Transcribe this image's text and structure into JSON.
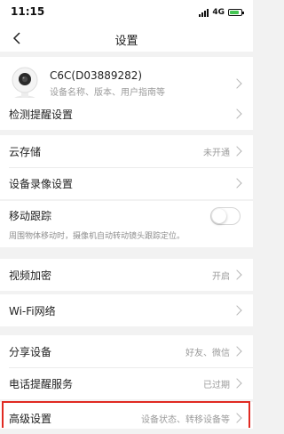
{
  "status_bar": {
    "time": "11:15",
    "network": "4G",
    "battery_level": 0.8,
    "battery_color": "#44c553"
  },
  "nav": {
    "back_icon": "chevron-left-icon",
    "title": "设置"
  },
  "device": {
    "icon": "camera-icon",
    "name": "C6C(D03889282)",
    "subtitle": "设备名称、版本、用户指南等"
  },
  "groups": {
    "detection": {
      "label": "检测提醒设置"
    },
    "cloud_storage": {
      "label": "云存储",
      "value": "未开通"
    },
    "recording": {
      "label": "设备录像设置"
    },
    "motion_tracking": {
      "label": "移动跟踪",
      "enabled": false,
      "hint": "周围物体移动时，摄像机自动转动镜头跟踪定位。"
    },
    "video_encryption": {
      "label": "视频加密",
      "value": "开启"
    },
    "wifi": {
      "label": "Wi-Fi网络"
    },
    "share": {
      "label": "分享设备",
      "value": "好友、微信"
    },
    "phone_alert": {
      "label": "电话提醒服务",
      "value": "已过期"
    },
    "advanced": {
      "label": "高级设置",
      "value": "设备状态、转移设备等"
    }
  },
  "highlight_color": "#e02a22"
}
